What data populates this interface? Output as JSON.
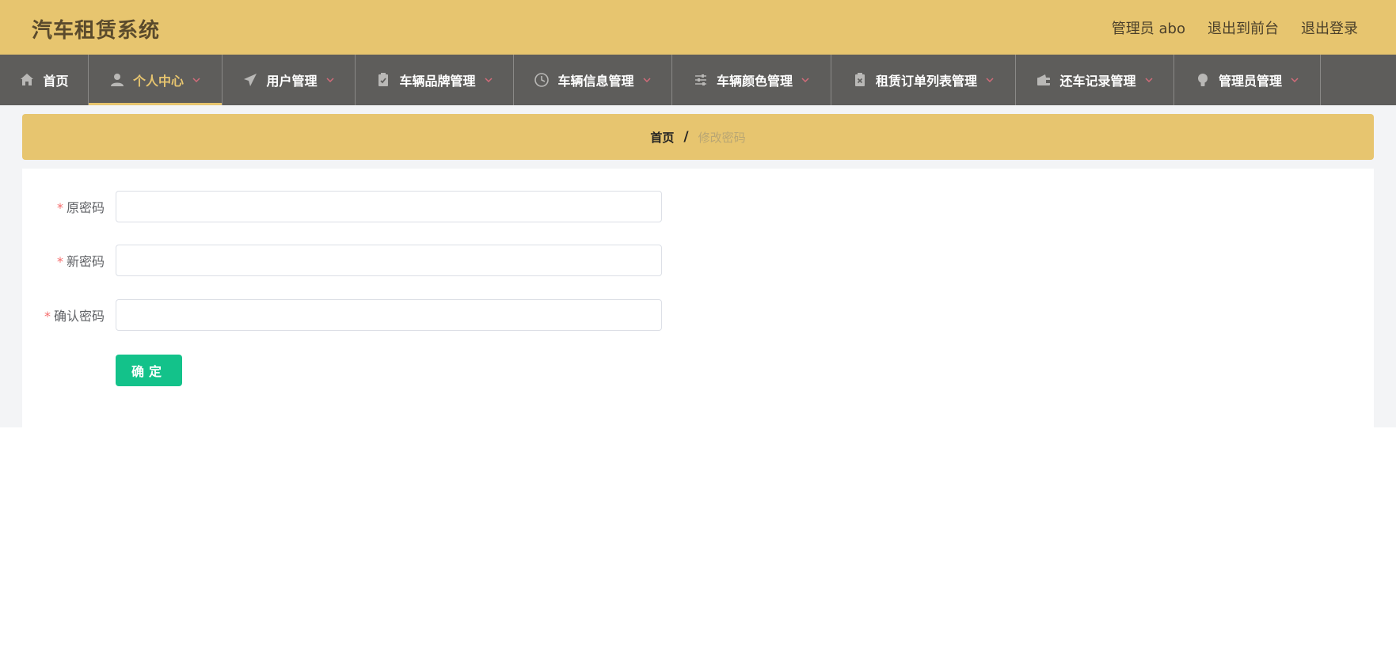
{
  "header": {
    "title": "汽车租赁系统",
    "links": [
      "管理员 abo",
      "退出到前台",
      "退出登录"
    ]
  },
  "nav": {
    "items": [
      {
        "label": "首页",
        "icon": "home-icon",
        "dropdown": false,
        "active": false
      },
      {
        "label": "个人中心",
        "icon": "user-icon",
        "dropdown": true,
        "active": true
      },
      {
        "label": "用户管理",
        "icon": "paper-plane-icon",
        "dropdown": true,
        "active": false
      },
      {
        "label": "车辆品牌管理",
        "icon": "clipboard-check-icon",
        "dropdown": true,
        "active": false
      },
      {
        "label": "车辆信息管理",
        "icon": "clock-icon",
        "dropdown": true,
        "active": false
      },
      {
        "label": "车辆颜色管理",
        "icon": "sliders-icon",
        "dropdown": true,
        "active": false
      },
      {
        "label": "租赁订单列表管理",
        "icon": "clipboard-x-icon",
        "dropdown": true,
        "active": false
      },
      {
        "label": "还车记录管理",
        "icon": "wallet-icon",
        "dropdown": true,
        "active": false
      },
      {
        "label": "管理员管理",
        "icon": "lightbulb-icon",
        "dropdown": true,
        "active": false
      }
    ]
  },
  "breadcrumb": {
    "home": "首页",
    "separator": "/",
    "current": "修改密码"
  },
  "form": {
    "required_mark": "*",
    "fields": [
      {
        "label": "原密码",
        "value": ""
      },
      {
        "label": "新密码",
        "value": ""
      },
      {
        "label": "确认密码",
        "value": ""
      }
    ],
    "submit_label": "确定"
  },
  "colors": {
    "header_bg": "#e7c56f",
    "nav_bg": "#5e5d5b",
    "nav_active": "#e7c56f",
    "chevron": "#d36b7a",
    "submit_bg": "#13c28a"
  }
}
